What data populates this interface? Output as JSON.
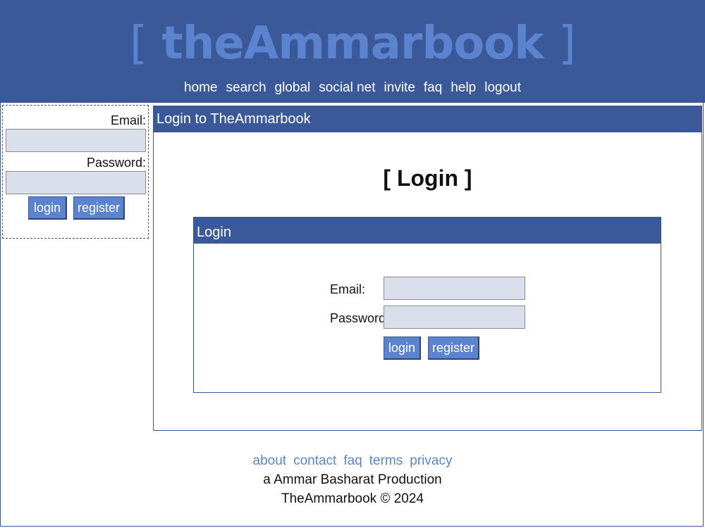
{
  "site": {
    "logo_open": "[",
    "logo_name": "theAmmarbook",
    "logo_close": "]"
  },
  "nav": [
    "home",
    "search",
    "global",
    "social net",
    "invite",
    "faq",
    "help",
    "logout"
  ],
  "sidebar": {
    "email_label": "Email:",
    "password_label": "Password:",
    "email_value": "",
    "password_value": "",
    "login_button": "login",
    "register_button": "register"
  },
  "main": {
    "bar_title": "Login to TheAmmarbook",
    "heading": "[ Login ]",
    "box_title": "Login",
    "email_label": "Email:",
    "password_label": "Password:",
    "email_value": "",
    "password_value": "",
    "login_button": "login",
    "register_button": "register"
  },
  "footer": {
    "links": [
      "about",
      "contact",
      "faq",
      "terms",
      "privacy"
    ],
    "credit": "a Ammar Basharat Production",
    "copyright": "TheAmmarbook © 2024"
  },
  "colors": {
    "brand_blue": "#3b5998",
    "accent_blue": "#5b83cf",
    "input_fill": "#d9dfeb"
  }
}
